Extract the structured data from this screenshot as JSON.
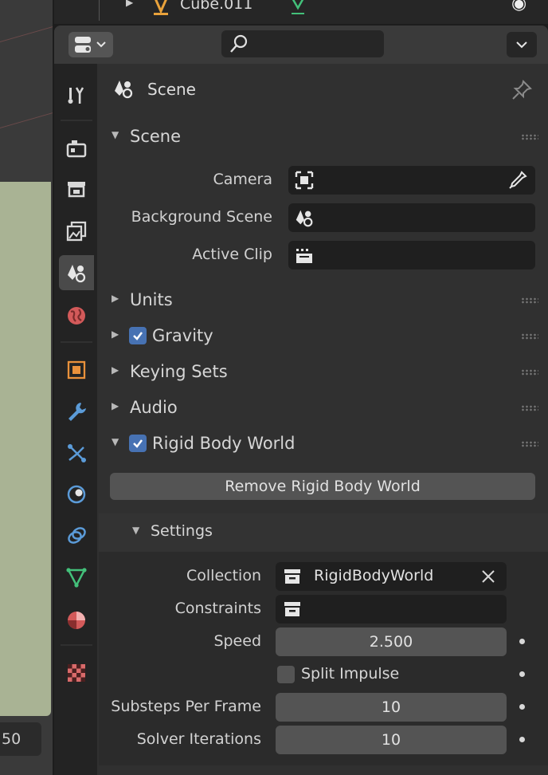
{
  "outliner": {
    "object_name": "Cube.011"
  },
  "viewport": {
    "frame_value": "50"
  },
  "properties": {
    "context_label": "Scene",
    "scene_panel": {
      "label": "Scene",
      "camera_label": "Camera",
      "background_scene_label": "Background Scene",
      "active_clip_label": "Active Clip"
    },
    "collapsed_panels": {
      "units": "Units",
      "gravity": "Gravity",
      "keying_sets": "Keying Sets",
      "audio": "Audio"
    },
    "rigid_body_world": {
      "label": "Rigid Body World",
      "enabled": true,
      "remove_button": "Remove Rigid Body World",
      "settings": {
        "label": "Settings",
        "collection_label": "Collection",
        "collection_value": "RigidBodyWorld",
        "constraints_label": "Constraints",
        "speed_label": "Speed",
        "speed_value": "2.500",
        "split_impulse_label": "Split Impulse",
        "substeps_label": "Substeps Per Frame",
        "substeps_value": "10",
        "solver_iterations_label": "Solver Iterations",
        "solver_iterations_value": "10"
      }
    }
  },
  "colors": {
    "accent_blue": "#4772b3",
    "panel_bg": "#303030",
    "field_bg": "#1f1f1f"
  }
}
